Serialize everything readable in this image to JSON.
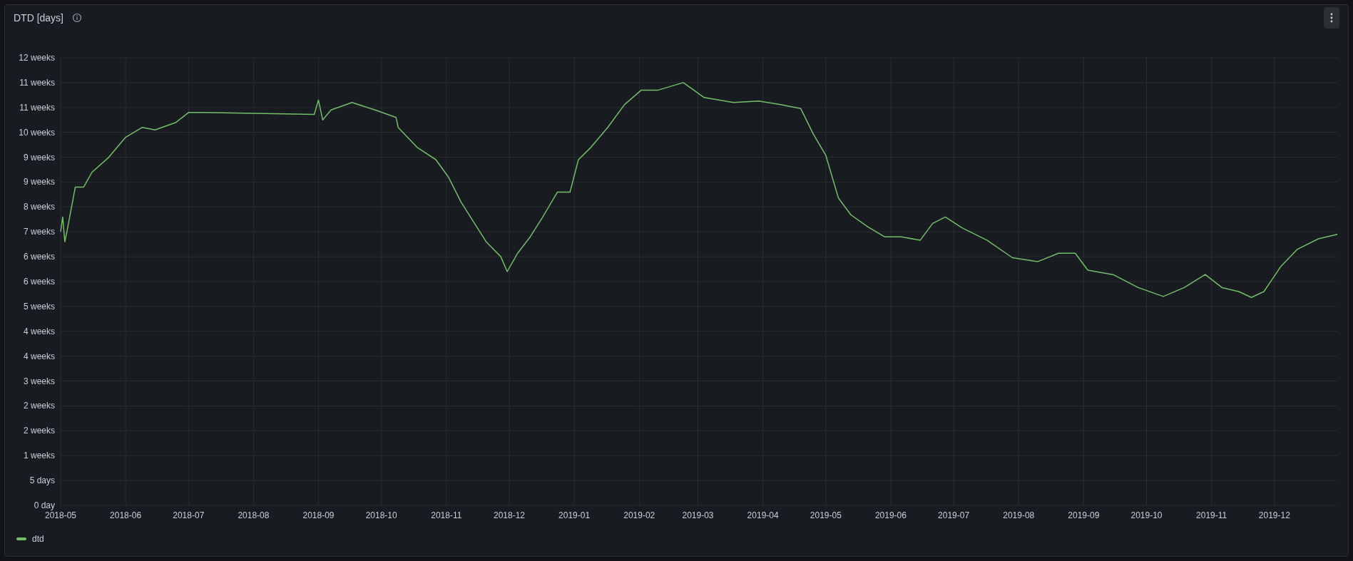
{
  "panel": {
    "title": "DTD [days]",
    "y_axis_labels": [
      "12 weeks",
      "11 weeks",
      "11 weeks",
      "10 weeks",
      "9 weeks",
      "9 weeks",
      "8 weeks",
      "7 weeks",
      "6 weeks",
      "6 weeks",
      "5 weeks",
      "4 weeks",
      "4 weeks",
      "3 weeks",
      "2 weeks",
      "2 weeks",
      "1 weeks",
      "5 days",
      "0 day"
    ],
    "x_axis_labels": [
      "2018-05",
      "2018-06",
      "2018-07",
      "2018-08",
      "2018-09",
      "2018-10",
      "2018-11",
      "2018-12",
      "2019-01",
      "2019-02",
      "2019-03",
      "2019-04",
      "2019-05",
      "2019-06",
      "2019-07",
      "2019-08",
      "2019-09",
      "2019-10",
      "2019-11",
      "2019-12"
    ]
  },
  "legend": [
    {
      "label": "dtd",
      "color": "#73bf69"
    }
  ]
}
